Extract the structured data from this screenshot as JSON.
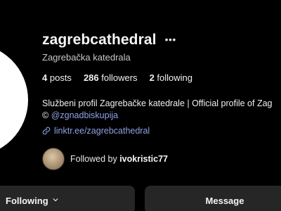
{
  "profile": {
    "username": "zagrebcathedral",
    "display_name": "Zagrebačka katedrala",
    "stats": {
      "posts_count": "4",
      "posts_label": "posts",
      "followers_count": "286",
      "followers_label": "followers",
      "following_count": "2",
      "following_label": "following"
    },
    "bio_line1": "Službeni profil Zagrebačke katedrale | Official profile of Zag",
    "bio_line2_prefix": "©",
    "bio_mention": "@zgnadbiskupija",
    "link": "linktr.ee/zagrebcathedral",
    "followed_by_prefix": "Followed by",
    "followed_by_user": "ivokristic77"
  },
  "icons": {
    "more": "more-horizontal-icon",
    "link": "link-icon",
    "chevron": "chevron-down-icon"
  },
  "buttons": {
    "following_label": "Following",
    "message_label": "Message"
  },
  "colors": {
    "background": "#000000",
    "button_bg": "#262626",
    "link": "#8fa2e6",
    "text": "#f5f5f5",
    "muted_text": "#c8c8c8"
  }
}
